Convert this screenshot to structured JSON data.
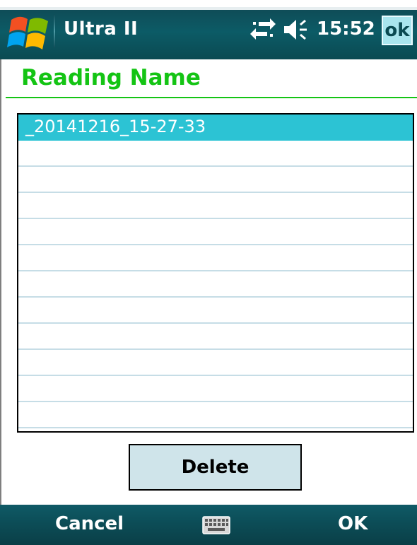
{
  "status_bar": {
    "app_title": "Ultra II",
    "time": "15:52",
    "ok_label": "ok",
    "icons": [
      "windows-start-icon",
      "connectivity-icon",
      "volume-icon"
    ]
  },
  "page": {
    "title": "Reading Name"
  },
  "readings": {
    "items": [
      "_20141216_15-27-33",
      "",
      "",
      "",
      "",
      "",
      "",
      "",
      "",
      "",
      "",
      ""
    ],
    "selected_index": 0
  },
  "actions": {
    "delete_label": "Delete"
  },
  "softkeys": {
    "left_label": "Cancel",
    "right_label": "OK",
    "center_icon": "keyboard-icon"
  },
  "colors": {
    "accent_green": "#14c414",
    "selection": "#2cc3d4",
    "bar_teal": "#0c5b66"
  }
}
